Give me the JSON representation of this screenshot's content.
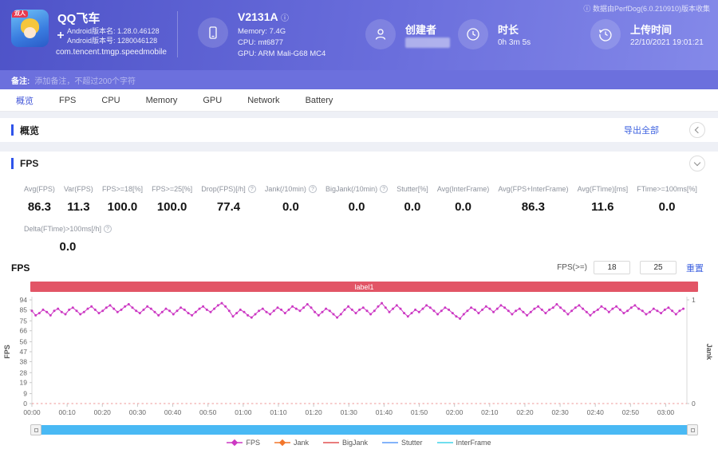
{
  "icons": {
    "info": "ⓘ",
    "help": "?"
  },
  "header": {
    "app": {
      "badge": "双人",
      "title": "QQ飞车",
      "version_name": "Android版本名: 1.28.0.46128",
      "version_code": "Android版本号: 1280046128",
      "package": "com.tencent.tmgp.speedmobile"
    },
    "device": {
      "model": "V2131A",
      "memory": "Memory: 7.4G",
      "cpu": "CPU: mt6877",
      "gpu": "GPU: ARM Mali-G68 MC4"
    },
    "creator": {
      "label": "创建者"
    },
    "duration": {
      "label": "时长",
      "value": "0h 3m 5s"
    },
    "upload": {
      "label": "上传时间",
      "value": "22/10/2021 19:01:21"
    },
    "source_note": "数据由PerfDog(6.0.210910)版本收集"
  },
  "note_bar": {
    "label": "备注:",
    "placeholder": "添加备注，不超过200个字符"
  },
  "tabs": [
    {
      "label": "概览",
      "active": true
    },
    {
      "label": "FPS",
      "active": false
    },
    {
      "label": "CPU",
      "active": false
    },
    {
      "label": "Memory",
      "active": false
    },
    {
      "label": "GPU",
      "active": false
    },
    {
      "label": "Network",
      "active": false
    },
    {
      "label": "Battery",
      "active": false
    }
  ],
  "overview_section": {
    "title": "概览",
    "export_label": "导出全部"
  },
  "fps_section": {
    "title": "FPS",
    "chart_title": "FPS",
    "threshold": {
      "label": "FPS(>=)",
      "v1": "18",
      "v2": "25",
      "reset_label": "重置"
    },
    "metrics_row1": [
      {
        "label": "Avg(FPS)",
        "value": "86.3",
        "help": false
      },
      {
        "label": "Var(FPS)",
        "value": "11.3",
        "help": false
      },
      {
        "label": "FPS>=18[%]",
        "value": "100.0",
        "help": false
      },
      {
        "label": "FPS>=25[%]",
        "value": "100.0",
        "help": false
      },
      {
        "label": "Drop(FPS)[/h]",
        "value": "77.4",
        "help": true
      },
      {
        "label": "Jank(/10min)",
        "value": "0.0",
        "help": true
      },
      {
        "label": "BigJank(/10min)",
        "value": "0.0",
        "help": true
      },
      {
        "label": "Stutter[%]",
        "value": "0.0",
        "help": false
      },
      {
        "label": "Avg(InterFrame)",
        "value": "0.0",
        "help": false
      },
      {
        "label": "Avg(FPS+InterFrame)",
        "value": "86.3",
        "help": false
      },
      {
        "label": "Avg(FTime)[ms]",
        "value": "11.6",
        "help": false
      },
      {
        "label": "FTime>=100ms[%]",
        "value": "0.0",
        "help": false
      }
    ],
    "metrics_row2": [
      {
        "label": "Delta(FTime)>100ms[/h]",
        "value": "0.0",
        "help": true
      }
    ]
  },
  "chart_data": {
    "type": "line",
    "banner_label": "label1",
    "ylabel_left": "FPS",
    "ylabel_right": "Jank",
    "ylim_left": [
      0,
      94
    ],
    "y_ticks_left": [
      94,
      85,
      75,
      66,
      56,
      47,
      38,
      28,
      19,
      9,
      0
    ],
    "ylim_right": [
      0,
      1
    ],
    "y_ticks_right": [
      1,
      0
    ],
    "x_ticks": [
      "00:00",
      "00:10",
      "00:20",
      "00:30",
      "00:40",
      "00:50",
      "01:00",
      "01:10",
      "01:20",
      "01:30",
      "01:40",
      "01:50",
      "02:00",
      "02:10",
      "02:20",
      "02:30",
      "02:40",
      "02:50",
      "03:00"
    ],
    "x_tick_seconds": [
      0,
      10,
      20,
      30,
      40,
      50,
      60,
      70,
      80,
      90,
      100,
      110,
      120,
      130,
      140,
      150,
      160,
      170,
      180
    ],
    "x_seconds_max": 186,
    "duration_seconds": 185,
    "series": [
      {
        "name": "FPS",
        "color": "#cc38c3",
        "marker": true,
        "values": [
          84,
          80,
          82,
          85,
          83,
          80,
          84,
          86,
          83,
          81,
          85,
          87,
          84,
          81,
          83,
          86,
          88,
          85,
          82,
          84,
          87,
          89,
          86,
          83,
          85,
          88,
          90,
          87,
          84,
          82,
          85,
          88,
          86,
          83,
          80,
          83,
          86,
          84,
          81,
          84,
          87,
          85,
          82,
          80,
          83,
          86,
          88,
          85,
          83,
          86,
          89,
          91,
          88,
          84,
          79,
          82,
          85,
          83,
          80,
          78,
          81,
          84,
          86,
          83,
          81,
          84,
          87,
          85,
          82,
          85,
          88,
          86,
          84,
          87,
          90,
          87,
          83,
          80,
          83,
          86,
          84,
          81,
          78,
          81,
          85,
          88,
          85,
          82,
          85,
          87,
          84,
          81,
          84,
          88,
          91,
          87,
          83,
          86,
          89,
          86,
          82,
          79,
          82,
          85,
          83,
          86,
          89,
          87,
          84,
          81,
          84,
          87,
          85,
          82,
          79,
          77,
          81,
          84,
          87,
          85,
          82,
          85,
          88,
          86,
          83,
          86,
          89,
          87,
          84,
          81,
          84,
          86,
          83,
          80,
          83,
          86,
          88,
          85,
          82,
          85,
          87,
          90,
          87,
          84,
          81,
          84,
          87,
          89,
          86,
          83,
          80,
          83,
          85,
          88,
          86,
          83,
          86,
          88,
          85,
          82,
          84,
          87,
          89,
          86,
          84,
          81,
          83,
          86,
          84,
          82,
          85,
          87,
          84,
          81,
          84,
          86
        ]
      },
      {
        "name": "Jank",
        "color": "#f2762b",
        "marker": true,
        "constant": 0
      },
      {
        "name": "BigJank",
        "color": "#e25050",
        "marker": false,
        "constant": 0
      },
      {
        "name": "Stutter",
        "color": "#5a9cf8",
        "marker": false,
        "constant": 0
      },
      {
        "name": "InterFrame",
        "color": "#40d3e8",
        "marker": false,
        "constant": 0
      }
    ],
    "zero_line_color": "#ef9a9a",
    "legend": [
      "FPS",
      "Jank",
      "BigJank",
      "Stutter",
      "InterFrame"
    ]
  }
}
